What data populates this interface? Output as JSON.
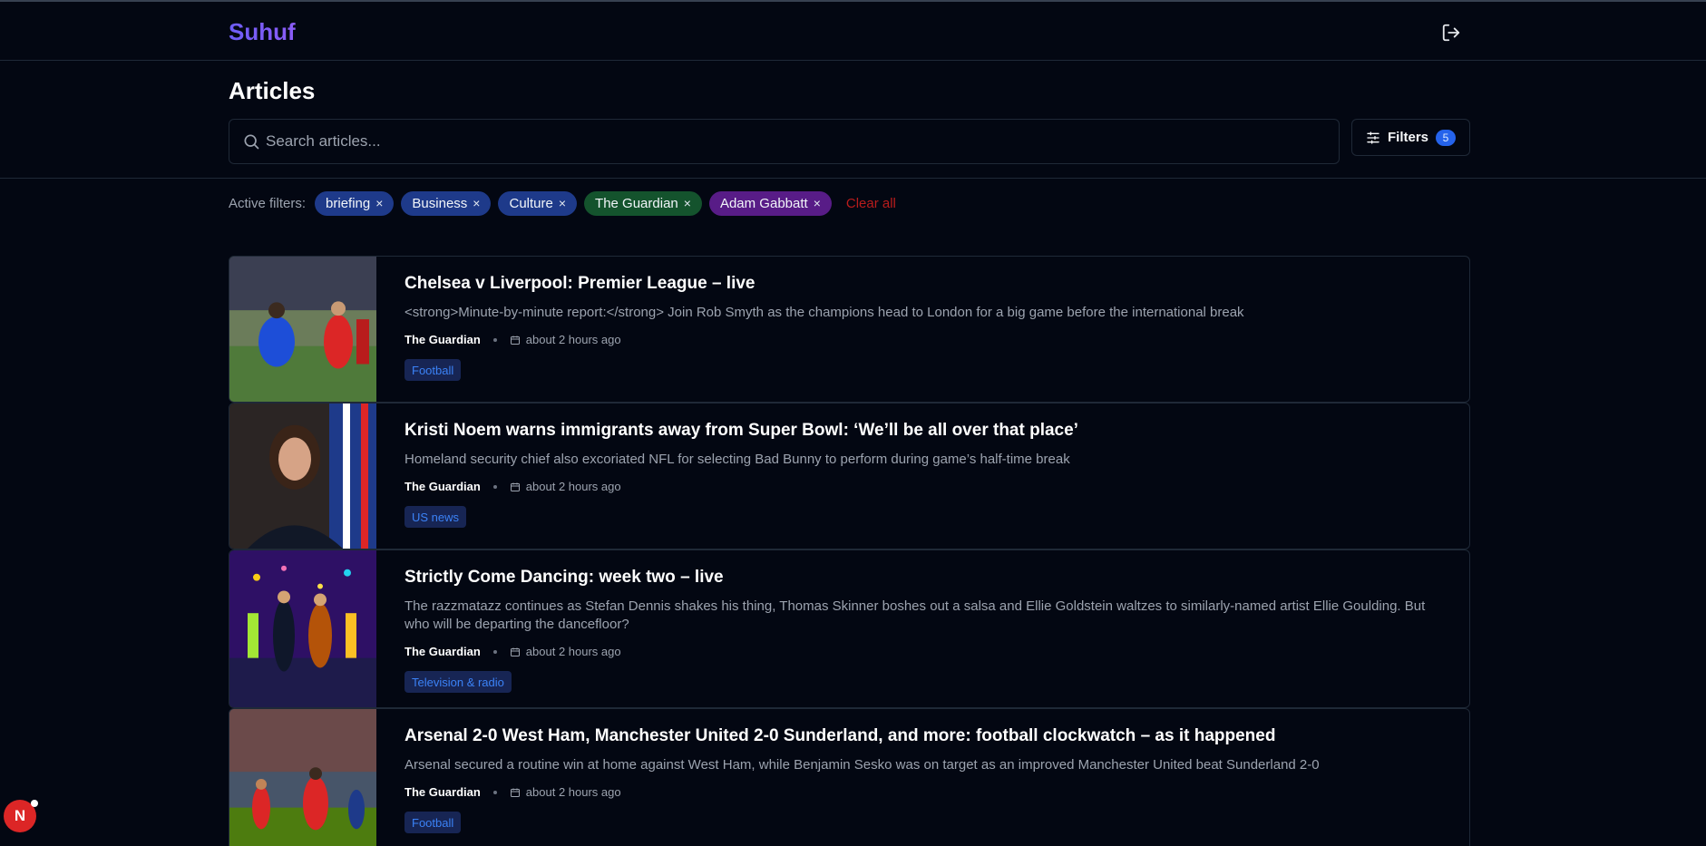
{
  "app": {
    "name": "Suhuf"
  },
  "page": {
    "title": "Articles"
  },
  "search": {
    "placeholder": "Search articles...",
    "value": ""
  },
  "filters": {
    "label": "Filters",
    "count": "5"
  },
  "active_filters": {
    "label": "Active filters:",
    "chips": [
      {
        "label": "briefing",
        "remove": "×",
        "color": "#1e3a8a"
      },
      {
        "label": "Business",
        "remove": "×",
        "color": "#1e3a8a"
      },
      {
        "label": "Culture",
        "remove": "×",
        "color": "#1e3a8a"
      },
      {
        "label": "The Guardian",
        "remove": "×",
        "color": "#14532d"
      },
      {
        "label": "Adam Gabbatt",
        "remove": "×",
        "color": "#581c87"
      }
    ],
    "clear_all": "Clear all"
  },
  "articles": [
    {
      "title": "Chelsea v Liverpool: Premier League – live",
      "description": "<strong>Minute-by-minute report:</strong> Join Rob Smyth as the champions head to London for a big game before the international break",
      "source": "The Guardian",
      "time": "about 2 hours ago",
      "tag": "Football"
    },
    {
      "title": "Kristi Noem warns immigrants away from Super Bowl: ‘We’ll be all over that place’",
      "description": "Homeland security chief also excoriated NFL for selecting Bad Bunny to perform during game’s half-time break",
      "source": "The Guardian",
      "time": "about 2 hours ago",
      "tag": "US news"
    },
    {
      "title": "Strictly Come Dancing: week two – live",
      "description": "The razzmatazz continues as Stefan Dennis shakes his thing, Thomas Skinner boshes out a salsa and Ellie Goldstein waltzes to similarly-named artist Ellie Goulding. But who will be departing the dancefloor?",
      "source": "The Guardian",
      "time": "about 2 hours ago",
      "tag": "Television & radio"
    },
    {
      "title": "Arsenal 2-0 West Ham, Manchester United 2-0 Sunderland, and more: football clockwatch – as it happened",
      "description": "Arsenal secured a routine win at home against West Ham, while Benjamin Sesko was on target as an improved Manchester United beat Sunderland 2-0",
      "source": "The Guardian",
      "time": "about 2 hours ago",
      "tag": "Football"
    }
  ],
  "notification": {
    "letter": "N"
  },
  "colors": {
    "background": "#030712",
    "accent": "#2563eb",
    "brand": "#7c5cf6",
    "danger": "#b91c1c"
  },
  "icons": [
    "logout-icon",
    "search-icon",
    "sliders-icon",
    "close-icon",
    "calendar-icon"
  ]
}
